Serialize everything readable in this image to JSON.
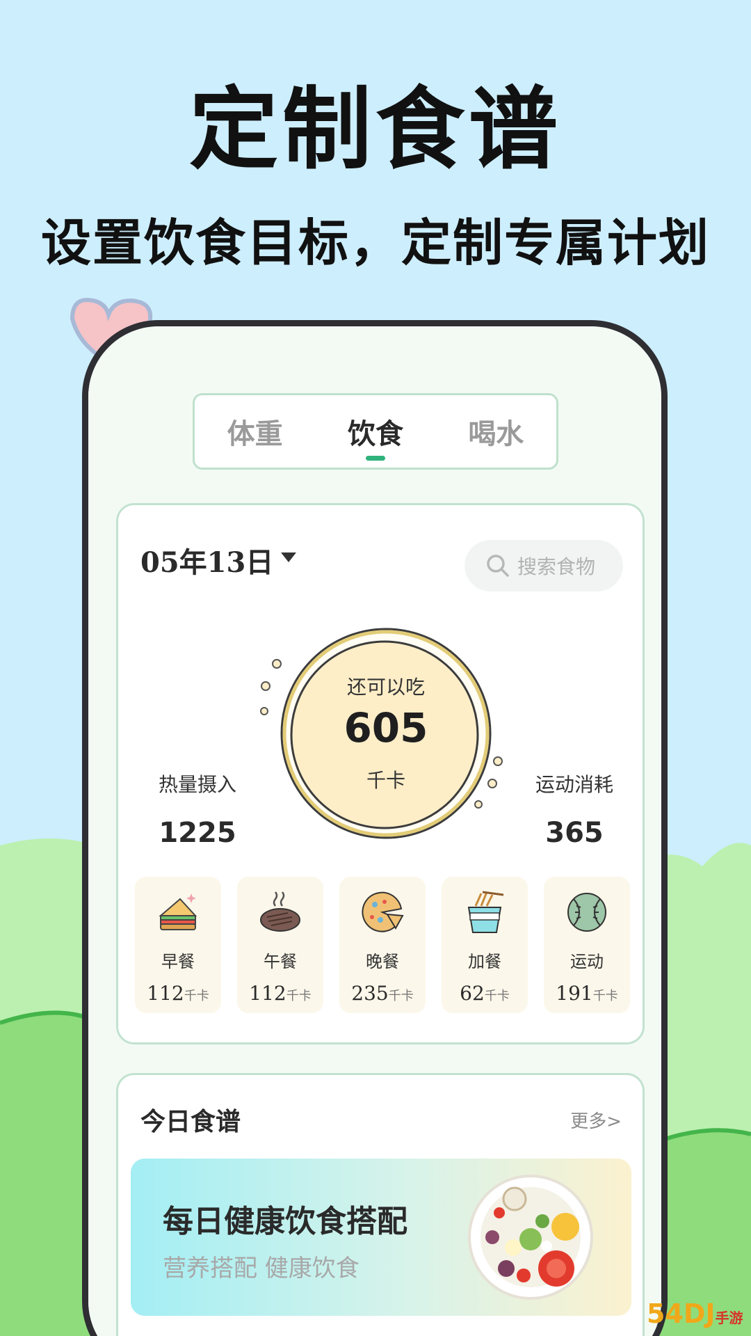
{
  "headline": "定制食谱",
  "subline": "设置饮食目标，定制专属计划",
  "tabs": [
    {
      "label": "体重",
      "active": false
    },
    {
      "label": "饮食",
      "active": true
    },
    {
      "label": "喝水",
      "active": false
    }
  ],
  "summary": {
    "date": "05年13日",
    "search_placeholder": "搜索食物",
    "remaining_label": "还可以吃",
    "remaining_value": "605",
    "remaining_unit": "千卡",
    "intake_label": "热量摄入",
    "intake_value": "1225",
    "burn_label": "运动消耗",
    "burn_value": "365"
  },
  "meals": [
    {
      "name": "早餐",
      "kcal": "112",
      "unit": "千卡",
      "icon": "sandwich-icon"
    },
    {
      "name": "午餐",
      "kcal": "112",
      "unit": "千卡",
      "icon": "steak-icon"
    },
    {
      "name": "晚餐",
      "kcal": "235",
      "unit": "千卡",
      "icon": "pizza-icon"
    },
    {
      "name": "加餐",
      "kcal": "62",
      "unit": "千卡",
      "icon": "noodle-cup-icon"
    },
    {
      "name": "运动",
      "kcal": "191",
      "unit": "千卡",
      "icon": "ball-icon"
    }
  ],
  "recipe": {
    "title": "今日食谱",
    "more": "更多>",
    "banner_title": "每日健康饮食搭配",
    "banner_sub": "营养搭配  健康饮食"
  },
  "watermark": {
    "main": "54DJ",
    "sub": "手游网"
  },
  "colors": {
    "sky": "#cdeefd",
    "grass": "#9be38b",
    "accent": "#2fb27c",
    "card_border": "#c2e2cf",
    "ring_fill": "#fdeec8"
  }
}
